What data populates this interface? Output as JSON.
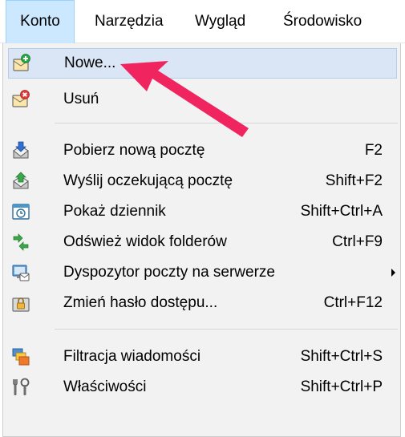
{
  "menubar": {
    "items": [
      {
        "label": "Konto"
      },
      {
        "label": "Narzędzia"
      },
      {
        "label": "Wygląd"
      },
      {
        "label": "Środowisko"
      }
    ]
  },
  "menu": {
    "items": [
      {
        "label": "Nowe...",
        "shortcut": "",
        "icon": "new-account-icon",
        "highlighted": true
      },
      {
        "label": "Usuń",
        "shortcut": "",
        "icon": "delete-account-icon"
      },
      {
        "label": "Pobierz nową pocztę",
        "shortcut": "F2",
        "icon": "download-mail-icon"
      },
      {
        "label": "Wyślij oczekującą pocztę",
        "shortcut": "Shift+F2",
        "icon": "send-mail-icon"
      },
      {
        "label": "Pokaż dziennik",
        "shortcut": "Shift+Ctrl+A",
        "icon": "log-icon"
      },
      {
        "label": "Odśwież widok folderów",
        "shortcut": "Ctrl+F9",
        "icon": "refresh-folders-icon"
      },
      {
        "label": "Dyspozytor poczty na serwerze",
        "shortcut": "",
        "icon": "server-mail-icon",
        "submenu": true
      },
      {
        "label": "Zmień hasło dostępu...",
        "shortcut": "Ctrl+F12",
        "icon": "change-password-icon"
      },
      {
        "label": "Filtracja wiadomości",
        "shortcut": "Shift+Ctrl+S",
        "icon": "filter-icon"
      },
      {
        "label": "Właściwości",
        "shortcut": "Shift+Ctrl+P",
        "icon": "properties-icon"
      }
    ]
  },
  "colors": {
    "menubar_active": "#cce8ff",
    "item_highlight": "#dae6f6",
    "annotation_arrow": "#f0245e"
  }
}
